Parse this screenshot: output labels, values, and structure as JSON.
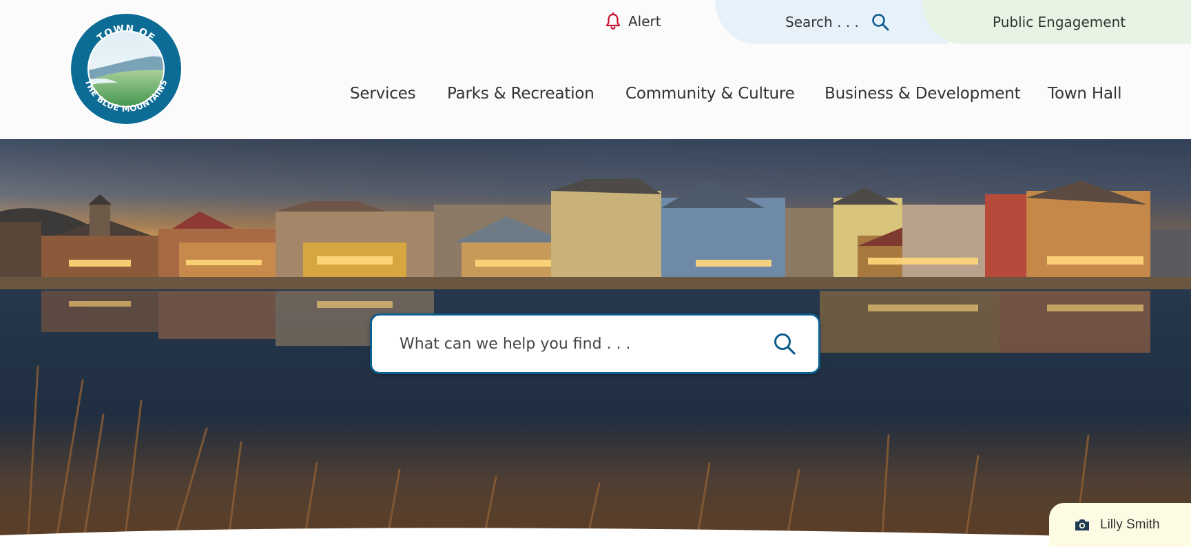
{
  "header": {
    "logo": {
      "top_text": "TOWN OF",
      "bottom_text": "THE BLUE MOUNTAINS"
    },
    "utility": {
      "alert_label": "Alert",
      "search_label": "Search . . .",
      "engagement_label": "Public Engagement"
    },
    "nav": [
      {
        "label": "Services"
      },
      {
        "label": "Parks & Recreation"
      },
      {
        "label": "Community & Culture"
      },
      {
        "label": "Business & Development"
      },
      {
        "label": "Town Hall"
      }
    ]
  },
  "hero": {
    "search_placeholder": "What can we help you find . . .",
    "photo_credit": "Lilly Smith"
  },
  "colors": {
    "brand_blue": "#0b5e8e",
    "alert_red": "#c8102e",
    "search_tab_bg": "#e6f1fa",
    "engagement_tab_bg": "#e7f4e3",
    "credit_bg": "#fdfbe4"
  },
  "icons": {
    "alert": "bell-icon",
    "search": "search-icon",
    "photo_credit": "camera-icon"
  }
}
